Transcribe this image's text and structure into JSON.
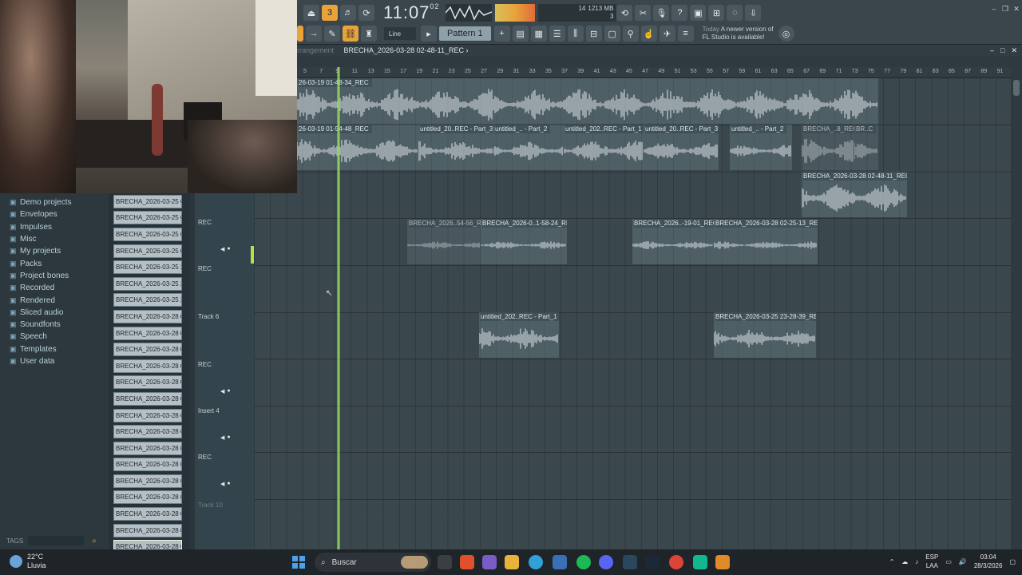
{
  "toolbar": {
    "clock": "11:07",
    "clock_frac": "02",
    "clock_sub": "B:S:T",
    "cpu_voices": "14",
    "cpu_mem": "1213 MB",
    "cpu_poly": "3",
    "snap_label": "Line",
    "pattern": "Pattern 1",
    "news_day": "Today",
    "news_text": "A newer version of",
    "news_text2": "FL Studio is available!"
  },
  "playlist": {
    "title_prefix": "rrangement",
    "title": "BRECHA_2026-03-28 02-48-11_REC",
    "ruler": [
      "5",
      "7",
      "9",
      "11",
      "13",
      "15",
      "17",
      "19",
      "21",
      "23",
      "25",
      "27",
      "29",
      "31",
      "33",
      "35",
      "37",
      "39",
      "41",
      "43",
      "45",
      "47",
      "49",
      "51",
      "53",
      "55",
      "57",
      "59",
      "61",
      "63",
      "65",
      "67",
      "69",
      "71",
      "73",
      "75",
      "77",
      "79",
      "81",
      "83",
      "85",
      "87",
      "89",
      "91",
      "93"
    ]
  },
  "browser": {
    "items": [
      "Demo projects",
      "Envelopes",
      "Impulses",
      "Misc",
      "My projects",
      "Packs",
      "Project bones",
      "Recorded",
      "Rendered",
      "Sliced audio",
      "Soundfonts",
      "Speech",
      "Templates",
      "User data"
    ],
    "tags_label": "TAGS"
  },
  "files": [
    "BRECHA_2026-03-25 00-...",
    "BRECHA_2026-03-25 00-...",
    "BRECHA_2026-03-25 00-...",
    "BRECHA_2026-03-25 00-...",
    "BRECHA_2026-03-25 23-...",
    "BRECHA_2026-03-25 23-...",
    "BRECHA_2026-03-25 23-...",
    "BRECHA_2026-03-28 01-...",
    "BRECHA_2026-03-28 01-...",
    "BRECHA_2026-03-28 01-...",
    "BRECHA_2026-03-28 01-...",
    "BRECHA_2026-03-28 01-...",
    "BRECHA_2026-03-28 02-...",
    "BRECHA_2026-03-28 02-...",
    "BRECHA_2026-03-28 02-...",
    "BRECHA_2026-03-28 02-...",
    "BRECHA_2026-03-28 02-...",
    "BRECHA_2026-03-28 02-...",
    "BRECHA_2026-03-28 02-...",
    "BRECHA_2026-03-28 02-...",
    "BRECHA_2026-03-28 02-...",
    "BRECHA_2026-03-28 02-..."
  ],
  "tracks": {
    "t_rec1": "REC",
    "t_rec2": "REC",
    "t_track6": "Track 6",
    "t_rec3": "REC",
    "t_insert4": "Insert 4",
    "t_rec4": "REC",
    "t_track10": "Track 10"
  },
  "clips": {
    "c1": "26-03-19 01-48-34_REC",
    "c2a": "26-03-19 01-54-48_REC",
    "c2b": "untitled_20..REC - Part_3",
    "c2c": "untitled_.. - Part_2",
    "c2d": "untitled_202..REC - Part_1",
    "c2e": "untitled_20..REC - Part_3",
    "c2f": "untitled_.. - Part_2",
    "c2g": "BRECHA_..8_REC",
    "c2h": "BR..C",
    "c3": "BRECHA_2026-03-28 02-48-11_REC",
    "c4a": "BRECHA_2026..54-56_RE",
    "c4b": "BRECHA_2026-0..1-58-24_REC",
    "c4c": "BRECHA_2026..-19-01_REC",
    "c4d": "BRECHA_2026-03-28 02-25-13_REC",
    "c5a": "untitled_202..REC - Part_1",
    "c5b": "BRECHA_2026-03-25 23-28-39_REC"
  },
  "taskbar": {
    "temp": "22°C",
    "weather": "Lluvia",
    "search": "Buscar",
    "lang1": "ESP",
    "lang2": "LAA",
    "time": "03:04",
    "date": "28/3/2026"
  },
  "colors": {
    "accent": "#e8a33a",
    "playhead": "#9be061",
    "clip": "#8a9ba3"
  }
}
